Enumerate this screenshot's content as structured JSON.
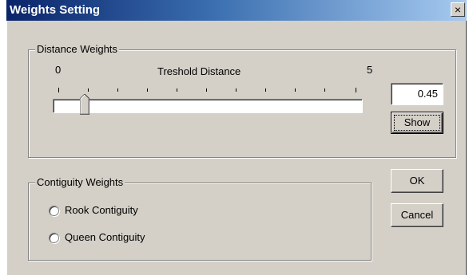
{
  "window": {
    "title": "Weights Setting",
    "close_label": "×"
  },
  "distance_group": {
    "legend": "Distance Weights",
    "min_label": "0",
    "max_label": "5",
    "slider_label": "Treshold Distance",
    "slider_value": 0.45,
    "value_text": "0.45",
    "show_button": "Show"
  },
  "contiguity_group": {
    "legend": "Contiguity Weights",
    "options": [
      "Rook Contiguity",
      "Queen Contiguity"
    ]
  },
  "buttons": {
    "ok": "OK",
    "cancel": "Cancel"
  }
}
